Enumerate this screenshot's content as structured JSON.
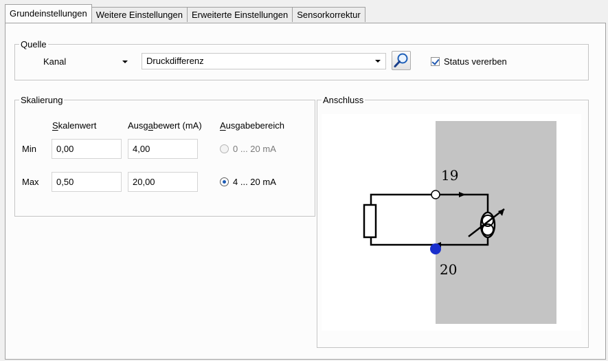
{
  "tabs": [
    "Grundeinstellungen",
    "Weitere Einstellungen",
    "Erweiterte Einstellungen",
    "Sensorkorrektur"
  ],
  "quelle": {
    "legend": "Quelle",
    "type_value": "Kanal",
    "channel_value": "Druckdifferenz",
    "inherit_status_label": "Status vererben",
    "inherit_status_checked": true
  },
  "skalierung": {
    "legend": "Skalierung",
    "headers": {
      "skalenwert_prefix": "S",
      "skalenwert_rest": "kalenwert",
      "ausgabewert_prefix": "Ausg",
      "ausgabewert_mid": "a",
      "ausgabewert_rest": "bewert (mA)",
      "ausgabebereich_prefix": "A",
      "ausgabebereich_rest": "usgabebereich"
    },
    "rows": [
      {
        "label": "Min",
        "skalenwert": "0,00",
        "ausgabewert": "4,00"
      },
      {
        "label": "Max",
        "skalenwert": "0,50",
        "ausgabewert": "20,00"
      }
    ],
    "ranges": [
      {
        "label": "0 ... 20 mA",
        "selected": false
      },
      {
        "label": "4 ... 20 mA",
        "selected": true
      }
    ]
  },
  "anschluss": {
    "legend": "Anschluss",
    "terminal_top": "19",
    "terminal_bottom": "20",
    "colors": {
      "panel": "#c4c4c4",
      "terminal_bottom": "#1a2fcc"
    }
  }
}
